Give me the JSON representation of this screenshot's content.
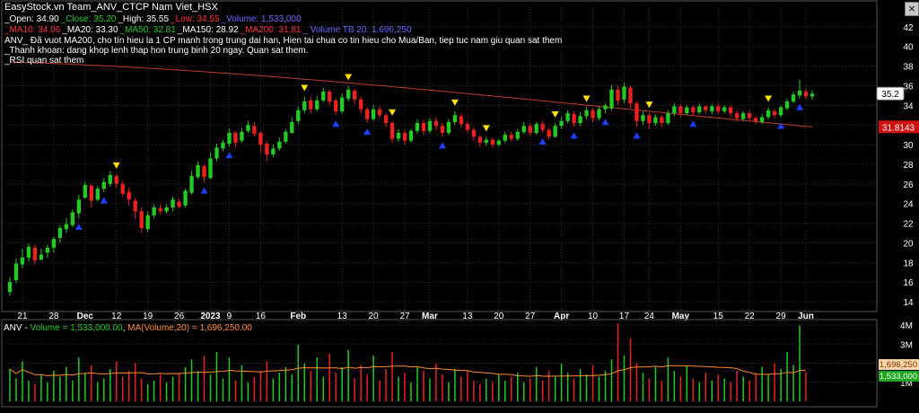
{
  "title": "EasyStock.vn Team_ANV_CTCP Nam Viet_HSX",
  "close_glyph": "×",
  "legend_row1": [
    {
      "label": "_Open: ",
      "value": "34.90",
      "color": "#ffffff"
    },
    {
      "label": "_Close: ",
      "value": "35.20",
      "color": "#22cc22"
    },
    {
      "label": "_High: ",
      "value": "35.55",
      "color": "#ffffff"
    },
    {
      "label": "_Low: ",
      "value": "34.55",
      "color": "#ff3333"
    },
    {
      "label": "_Volume: ",
      "value": "1,533,000",
      "color": "#6a6aff"
    }
  ],
  "legend_row2": [
    {
      "label": "_MA10: ",
      "value": "34.06",
      "color": "#ff3333"
    },
    {
      "label": "_MA20: ",
      "value": "33.30",
      "color": "#ffffff"
    },
    {
      "label": "_MA50: ",
      "value": "32.81",
      "color": "#22cc22"
    },
    {
      "label": "_MA150: ",
      "value": "28.92",
      "color": "#ffffff"
    },
    {
      "label": "_MA200: ",
      "value": "31.81",
      "color": "#ff3333"
    },
    {
      "label": "_ Volume TB 20: ",
      "value": "1,696,250",
      "color": "#6a6aff"
    }
  ],
  "notes": [
    "ANV_ Đã vuot MA200, cho tín hieu la 1 CP manh trong trung dai han, Hien tai chua co tin hieu cho Mua/Ban, tiep tuc nam giu quan sat them",
    "_Thanh khoan: dang khop lenh thap hon trung binh 20 ngay. Quan sat them.",
    "_RSI quan sat them"
  ],
  "volume_legend": {
    "prefix": "ANV - ",
    "vol_label": "Volume = 1,533,000.00",
    "sep": ", ",
    "ma_label": "MA(Volume,20) = 1,696,250.00"
  },
  "colors": {
    "up": "#22cc22",
    "down": "#ee2020",
    "ma200": "#c0392b",
    "buy_marker": "#1f3fff",
    "sell_marker": "#ffe000",
    "grid": "#303030",
    "axis_text": "#ffffff",
    "volume_ma": "#ff8c2a"
  },
  "chart_data": {
    "type": "candlestick",
    "symbol": "ANV",
    "ylim": [
      13,
      44
    ],
    "yticks": [
      14,
      16,
      18,
      20,
      22,
      24,
      26,
      28,
      30,
      32,
      34,
      36,
      38,
      40,
      42
    ],
    "last_price_label": "35.2",
    "ma200_label": "31.8143",
    "xticks": [
      {
        "i": 2,
        "label": "21"
      },
      {
        "i": 7,
        "label": "28"
      },
      {
        "i": 12,
        "label": "Dec"
      },
      {
        "i": 17,
        "label": "12"
      },
      {
        "i": 22,
        "label": "19"
      },
      {
        "i": 27,
        "label": "26"
      },
      {
        "i": 32,
        "label": "2023"
      },
      {
        "i": 35,
        "label": "9"
      },
      {
        "i": 40,
        "label": "16"
      },
      {
        "i": 46,
        "label": "Feb"
      },
      {
        "i": 53,
        "label": "13"
      },
      {
        "i": 58,
        "label": "20"
      },
      {
        "i": 63,
        "label": "27"
      },
      {
        "i": 67,
        "label": "Mar"
      },
      {
        "i": 73,
        "label": "13"
      },
      {
        "i": 78,
        "label": "20"
      },
      {
        "i": 83,
        "label": "27"
      },
      {
        "i": 88,
        "label": "Apr"
      },
      {
        "i": 93,
        "label": "10"
      },
      {
        "i": 98,
        "label": "17"
      },
      {
        "i": 102,
        "label": "24"
      },
      {
        "i": 107,
        "label": "May"
      },
      {
        "i": 113,
        "label": "15"
      },
      {
        "i": 118,
        "label": "22"
      },
      {
        "i": 123,
        "label": "29"
      },
      {
        "i": 127,
        "label": "Jun"
      }
    ],
    "candles": [
      [
        15.0,
        16.0,
        14.6,
        16.5
      ],
      [
        16.2,
        17.9,
        15.9,
        18.4
      ],
      [
        17.8,
        18.5,
        17.4,
        19.4
      ],
      [
        18.5,
        19.6,
        18.1,
        19.9
      ],
      [
        19.5,
        18.2,
        17.8,
        19.8
      ],
      [
        18.3,
        18.8,
        18.2,
        19.4
      ],
      [
        19.0,
        19.5,
        18.5,
        19.8
      ],
      [
        19.5,
        20.4,
        19.0,
        20.6
      ],
      [
        20.5,
        21.5,
        20.0,
        21.8
      ],
      [
        21.4,
        21.9,
        21.0,
        22.5
      ],
      [
        21.8,
        23.1,
        21.6,
        23.4
      ],
      [
        23.0,
        24.4,
        22.5,
        24.9
      ],
      [
        24.6,
        25.9,
        24.5,
        26.2
      ],
      [
        25.8,
        24.3,
        23.6,
        26.0
      ],
      [
        24.4,
        25.5,
        24.2,
        25.8
      ],
      [
        25.5,
        26.2,
        25.2,
        26.6
      ],
      [
        26.0,
        26.9,
        25.7,
        27.3
      ],
      [
        26.8,
        26.0,
        25.6,
        27.0
      ],
      [
        26.0,
        25.0,
        24.7,
        26.3
      ],
      [
        25.2,
        24.4,
        23.8,
        25.6
      ],
      [
        24.3,
        23.2,
        22.4,
        24.6
      ],
      [
        23.2,
        21.5,
        21.0,
        23.6
      ],
      [
        21.4,
        22.8,
        21.1,
        23.2
      ],
      [
        22.8,
        23.6,
        22.5,
        23.9
      ],
      [
        23.5,
        23.2,
        22.9,
        23.9
      ],
      [
        23.2,
        23.6,
        23.0,
        23.9
      ],
      [
        23.6,
        24.4,
        23.2,
        24.7
      ],
      [
        24.2,
        23.7,
        23.5,
        24.5
      ],
      [
        23.8,
        25.3,
        23.6,
        25.5
      ],
      [
        25.1,
        26.8,
        24.9,
        27.3
      ],
      [
        26.7,
        27.9,
        26.5,
        28.3
      ],
      [
        27.8,
        26.7,
        26.2,
        28.0
      ],
      [
        26.6,
        28.6,
        26.5,
        29.2
      ],
      [
        28.6,
        29.7,
        28.3,
        30.1
      ],
      [
        29.6,
        30.2,
        29.3,
        30.5
      ],
      [
        30.1,
        31.2,
        29.8,
        31.6
      ],
      [
        31.2,
        30.2,
        29.7,
        31.4
      ],
      [
        30.4,
        31.3,
        30.2,
        31.7
      ],
      [
        31.4,
        32.0,
        31.2,
        32.4
      ],
      [
        31.9,
        31.1,
        30.8,
        32.3
      ],
      [
        31.2,
        30.0,
        29.2,
        31.4
      ],
      [
        30.1,
        29.0,
        28.3,
        30.3
      ],
      [
        29.0,
        29.6,
        28.7,
        30.0
      ],
      [
        29.6,
        30.3,
        29.4,
        30.7
      ],
      [
        30.3,
        31.3,
        30.1,
        31.6
      ],
      [
        31.2,
        32.3,
        31.1,
        32.8
      ],
      [
        32.4,
        33.5,
        32.1,
        33.9
      ],
      [
        33.5,
        34.4,
        33.2,
        34.9
      ],
      [
        34.5,
        33.6,
        33.2,
        34.9
      ],
      [
        33.6,
        34.5,
        33.4,
        35.0
      ],
      [
        34.5,
        35.4,
        34.3,
        35.8
      ],
      [
        35.4,
        34.4,
        34.0,
        35.6
      ],
      [
        34.5,
        33.4,
        33.0,
        34.7
      ],
      [
        33.4,
        34.8,
        33.2,
        35.2
      ],
      [
        34.7,
        35.6,
        34.4,
        36.0
      ],
      [
        35.5,
        34.6,
        34.1,
        35.7
      ],
      [
        34.6,
        33.6,
        33.2,
        34.9
      ],
      [
        33.6,
        32.6,
        32.2,
        33.8
      ],
      [
        32.6,
        33.6,
        32.4,
        34.0
      ],
      [
        33.6,
        33.0,
        32.7,
        33.9
      ],
      [
        33.0,
        32.2,
        31.8,
        33.2
      ],
      [
        32.2,
        30.6,
        30.2,
        32.4
      ],
      [
        30.6,
        31.2,
        30.3,
        31.6
      ],
      [
        31.2,
        30.4,
        30.0,
        31.5
      ],
      [
        30.4,
        31.4,
        30.2,
        31.6
      ],
      [
        31.4,
        32.2,
        31.1,
        32.6
      ],
      [
        32.2,
        31.4,
        31.0,
        32.5
      ],
      [
        31.4,
        32.4,
        31.2,
        32.7
      ],
      [
        32.4,
        31.9,
        31.5,
        32.8
      ],
      [
        31.9,
        31.2,
        30.8,
        32.2
      ],
      [
        31.2,
        32.3,
        31.0,
        32.6
      ],
      [
        32.3,
        33.0,
        32.0,
        33.4
      ],
      [
        32.9,
        32.1,
        31.7,
        33.2
      ],
      [
        32.1,
        31.5,
        31.2,
        32.4
      ],
      [
        31.5,
        30.8,
        30.4,
        31.8
      ],
      [
        30.8,
        30.2,
        29.8,
        31.0
      ],
      [
        30.2,
        30.5,
        29.9,
        30.8
      ],
      [
        30.5,
        30.0,
        29.7,
        30.7
      ],
      [
        30.0,
        30.4,
        29.8,
        30.6
      ],
      [
        30.4,
        31.0,
        30.2,
        31.3
      ],
      [
        31.0,
        30.6,
        30.3,
        31.3
      ],
      [
        30.6,
        31.3,
        30.4,
        31.6
      ],
      [
        31.3,
        31.9,
        31.1,
        32.3
      ],
      [
        31.9,
        31.2,
        30.9,
        32.1
      ],
      [
        31.2,
        32.1,
        31.0,
        32.3
      ],
      [
        32.1,
        31.5,
        31.2,
        32.4
      ],
      [
        31.5,
        30.8,
        30.5,
        31.7
      ],
      [
        30.8,
        31.9,
        30.7,
        32.2
      ],
      [
        31.9,
        32.4,
        31.6,
        32.8
      ],
      [
        32.4,
        33.2,
        32.2,
        33.5
      ],
      [
        33.1,
        32.2,
        31.8,
        33.4
      ],
      [
        32.2,
        32.9,
        31.9,
        33.3
      ],
      [
        32.9,
        33.5,
        32.6,
        33.8
      ],
      [
        33.5,
        32.7,
        32.3,
        33.7
      ],
      [
        32.7,
        33.6,
        32.5,
        33.9
      ],
      [
        33.6,
        34.0,
        33.2,
        34.2
      ],
      [
        33.7,
        35.6,
        33.5,
        36.1
      ],
      [
        35.6,
        34.5,
        34.0,
        36.0
      ],
      [
        34.6,
        35.9,
        34.2,
        36.3
      ],
      [
        35.8,
        34.2,
        33.7,
        36.0
      ],
      [
        34.2,
        32.4,
        31.8,
        34.4
      ],
      [
        32.4,
        33.0,
        32.0,
        33.4
      ],
      [
        33.0,
        32.2,
        31.6,
        33.2
      ],
      [
        32.2,
        32.8,
        31.9,
        33.1
      ],
      [
        32.8,
        32.2,
        31.8,
        33.0
      ],
      [
        32.2,
        33.2,
        32.0,
        33.5
      ],
      [
        33.2,
        33.9,
        32.9,
        34.2
      ],
      [
        33.9,
        33.2,
        32.8,
        34.1
      ],
      [
        33.2,
        33.8,
        33.0,
        34.0
      ],
      [
        33.8,
        33.3,
        33.0,
        34.0
      ],
      [
        33.3,
        33.9,
        33.1,
        34.2
      ],
      [
        33.9,
        33.5,
        33.2,
        34.0
      ],
      [
        33.4,
        33.9,
        33.1,
        34.1
      ],
      [
        33.9,
        33.4,
        33.1,
        34.2
      ],
      [
        33.4,
        33.8,
        33.2,
        34.0
      ],
      [
        33.8,
        33.2,
        32.8,
        34.0
      ],
      [
        33.2,
        32.7,
        32.4,
        33.5
      ],
      [
        32.6,
        33.2,
        32.4,
        33.4
      ],
      [
        33.2,
        32.7,
        32.4,
        33.5
      ],
      [
        32.7,
        32.4,
        32.1,
        32.9
      ],
      [
        32.3,
        32.8,
        32.1,
        33.1
      ],
      [
        32.8,
        33.5,
        32.6,
        33.8
      ],
      [
        33.4,
        33.0,
        32.7,
        33.6
      ],
      [
        33.0,
        33.8,
        32.8,
        34.0
      ],
      [
        33.7,
        34.4,
        33.5,
        34.7
      ],
      [
        34.4,
        35.1,
        34.2,
        35.4
      ],
      [
        35.0,
        35.5,
        34.7,
        36.6
      ],
      [
        35.4,
        34.9,
        34.6,
        35.7
      ],
      [
        34.9,
        35.2,
        34.55,
        35.55
      ]
    ],
    "ma200": {
      "start": 48,
      "from": 38.4,
      "to": 31.81
    },
    "buy_markers": [
      11,
      15,
      31,
      35,
      52,
      57,
      69,
      85,
      90,
      95,
      100,
      109,
      123,
      126
    ],
    "sell_markers": [
      17,
      47,
      54,
      61,
      71,
      76,
      87,
      92,
      102,
      121
    ],
    "volume": {
      "ylim": [
        0,
        4200000
      ],
      "yticks": [
        {
          "v": 1000000,
          "label": "1M"
        },
        {
          "v": 2000000,
          "label": "2M"
        },
        {
          "v": 3000000,
          "label": "3M"
        },
        {
          "v": 4000000,
          "label": "4M"
        }
      ],
      "ma_label": "1,696,250",
      "vol_label": "1,533,000",
      "values": [
        1.7,
        1.2,
        2.1,
        1.1,
        0.9,
        1.4,
        1.0,
        1.6,
        1.3,
        1.8,
        1.1,
        2.3,
        1.5,
        1.9,
        1.0,
        1.2,
        1.7,
        2.1,
        1.3,
        1.6,
        2.0,
        1.2,
        0.9,
        1.1,
        1.4,
        1.0,
        1.3,
        1.5,
        1.8,
        2.2,
        1.6,
        2.4,
        1.4,
        2.6,
        1.2,
        2.3,
        1.1,
        1.9,
        1.0,
        1.3,
        1.6,
        2.1,
        1.2,
        1.5,
        1.8,
        1.4,
        3.0,
        2.0,
        1.6,
        2.3,
        1.3,
        2.5,
        1.5,
        1.8,
        2.7,
        1.2,
        1.9,
        1.4,
        2.4,
        1.1,
        1.7,
        2.6,
        1.3,
        1.5,
        1.0,
        1.8,
        1.6,
        1.2,
        2.0,
        1.4,
        1.0,
        1.7,
        1.3,
        1.6,
        1.1,
        0.9,
        1.2,
        1.0,
        1.4,
        1.1,
        1.3,
        1.5,
        1.0,
        1.2,
        1.8,
        1.1,
        1.6,
        1.3,
        2.0,
        1.5,
        1.2,
        1.7,
        1.4,
        1.9,
        1.3,
        1.6,
        2.2,
        4.1,
        2.4,
        3.3,
        2.0,
        1.5,
        1.2,
        1.8,
        1.1,
        2.3,
        1.6,
        1.3,
        1.9,
        1.2,
        1.0,
        1.5,
        1.1,
        1.4,
        1.2,
        1.0,
        1.6,
        1.3,
        1.1,
        1.5,
        1.8,
        1.4,
        2.0,
        1.7,
        2.6,
        1.9,
        4.0,
        1.53
      ],
      "ma20_start": 1.75,
      "ma20_end": 1.7
    }
  }
}
